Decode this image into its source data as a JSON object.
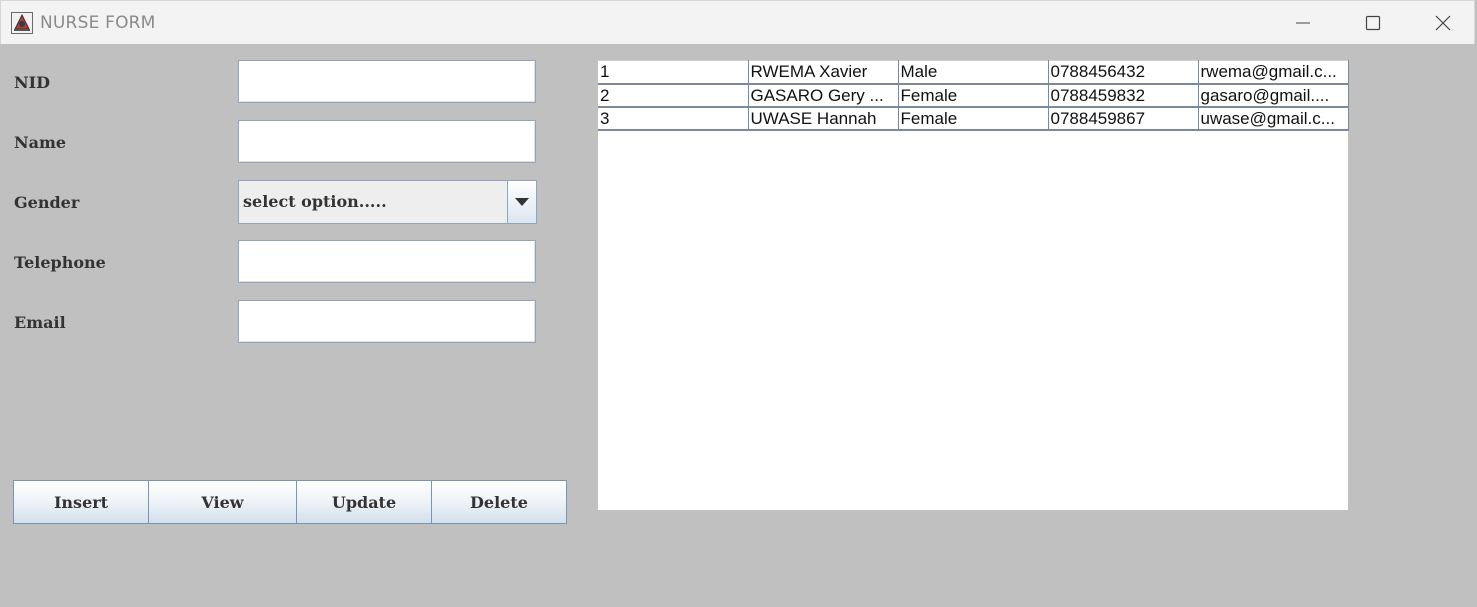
{
  "window": {
    "title": "NURSE FORM",
    "icons": {
      "app": "java-app-icon",
      "minimize": "minimize-icon",
      "maximize": "maximize-icon",
      "close": "close-icon"
    }
  },
  "form": {
    "nid_label": "NID",
    "name_label": "Name",
    "gender_label": "Gender",
    "telephone_label": "Telephone",
    "email_label": "Email",
    "nid_value": "",
    "name_value": "",
    "telephone_value": "",
    "email_value": "",
    "gender_selected": "select option.....",
    "gender_arrow_icon": "chevron-down-icon"
  },
  "buttons": {
    "insert": "Insert",
    "view": "View",
    "update": "Update",
    "delete": "Delete"
  },
  "table": {
    "rows": [
      {
        "id": "1",
        "name": "RWEMA Xavier",
        "gender": "Male",
        "telephone": "0788456432",
        "email": "rwema@gmail.c..."
      },
      {
        "id": "2",
        "name": "GASARO Gery ...",
        "gender": "Female",
        "telephone": "0788459832",
        "email": "gasaro@gmail...."
      },
      {
        "id": "3",
        "name": "UWASE Hannah",
        "gender": "Female",
        "telephone": "0788459867",
        "email": "uwase@gmail.c..."
      }
    ]
  },
  "colors": {
    "window_bg": "#c0c0c0",
    "titlebar_bg": "#f3f3f3",
    "field_border": "#8fa6bf",
    "button_gradient_bottom": "#d4e0ec"
  }
}
